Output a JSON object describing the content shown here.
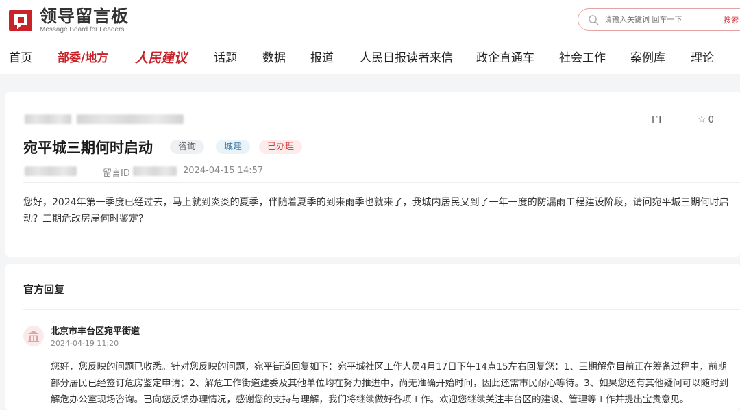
{
  "header": {
    "logo_title": "领导留言板",
    "logo_subtitle": "Message Board for Leaders",
    "search_placeholder": "请输入关键词 回车一下",
    "search_button": "搜索"
  },
  "nav": [
    {
      "label": "首页",
      "active": false
    },
    {
      "label": "部委/地方",
      "active": true
    },
    {
      "label": "人民建议",
      "active": false,
      "brand": true
    },
    {
      "label": "话题",
      "active": false
    },
    {
      "label": "数据",
      "active": false
    },
    {
      "label": "报道",
      "active": false
    },
    {
      "label": "人民日报读者来信",
      "active": false
    },
    {
      "label": "政企直通车",
      "active": false
    },
    {
      "label": "社会工作",
      "active": false
    },
    {
      "label": "案例库",
      "active": false
    },
    {
      "label": "理论",
      "active": false
    }
  ],
  "message": {
    "title": "宛平城三期何时启动",
    "tags": [
      "咨询",
      "城建",
      "已办理"
    ],
    "favorite_count": "0",
    "font_toggle": "TT",
    "id_label": "留言ID",
    "date": "2024-04-15 14:57",
    "content": "您好，2024年第一季度已经过去，马上就到炎炎的夏季，伴随着夏季的到来雨季也就来了，我城内居民又到了一年一度的防漏雨工程建设阶段，请问宛平城三期何时启动？三期危改房屋何时鉴定？"
  },
  "reply": {
    "heading": "官方回复",
    "org": "北京市丰台区宛平街道",
    "date": "2024-04-19 11:20",
    "content": "您好，您反映的问题已收悉。针对您反映的问题，宛平街道回复如下：宛平城社区工作人员4月17日下午14点15左右回复您：1、三期解危目前正在筹备过程中，前期部分居民已经签订危房鉴定申请；2、解危工作街道建委及其他单位均在努力推进中，尚无准确开始时间，因此还需市民耐心等待。3、如果您还有其他疑问可以随时到解危办公室现场咨询。已向您反馈办理情况，感谢您的支持与理解，我们将继续做好各项工作。欢迎您继续关注丰台区的建设、管理等工作并提出宝贵意见。"
  },
  "colors": {
    "brand_red": "#c8222a",
    "tag_done_text": "#d33a3a",
    "tag_city_text": "#4a7ea3"
  }
}
